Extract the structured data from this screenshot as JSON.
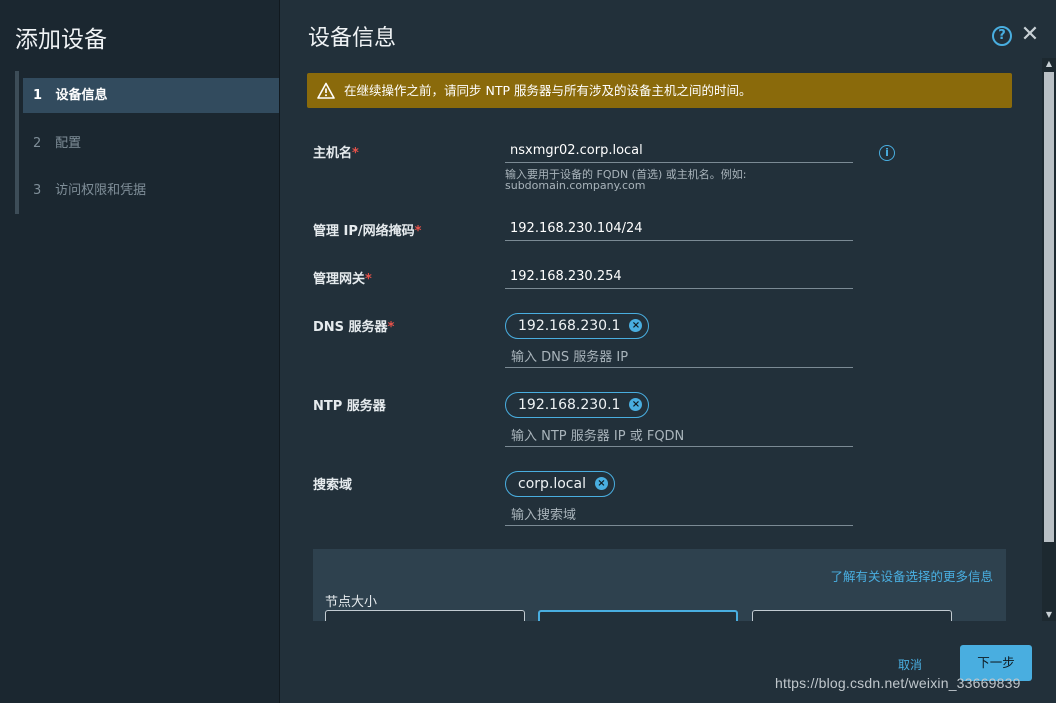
{
  "sidebar": {
    "title": "添加设备",
    "steps": [
      {
        "num": "1",
        "label": "设备信息",
        "active": true
      },
      {
        "num": "2",
        "label": "配置",
        "active": false
      },
      {
        "num": "3",
        "label": "访问权限和凭据",
        "active": false
      }
    ]
  },
  "header": {
    "title": "设备信息",
    "help_icon": "help-circle-icon",
    "help_glyph": "?",
    "close_icon": "close-icon",
    "close_glyph": "✕"
  },
  "alert": {
    "icon": "warning-triangle-icon",
    "text": "在继续操作之前，请同步 NTP 服务器与所有涉及的设备主机之间的时间。",
    "color": "#8a6a0b"
  },
  "form": {
    "hostname": {
      "label": "主机名",
      "required": "*",
      "value": "nsxmgr02.corp.local",
      "helper_line1": "输入要用于设备的 FQDN (首选) 或主机名。例如:",
      "helper_line2": "subdomain.company.com",
      "info_glyph": "i"
    },
    "mgmt_ip": {
      "label": "管理 IP/网络掩码",
      "required": "*",
      "value": "192.168.230.104/24"
    },
    "mgmt_gateway": {
      "label": "管理网关",
      "required": "*",
      "value": "192.168.230.254"
    },
    "dns": {
      "label": "DNS 服务器",
      "required": "*",
      "chip": "192.168.230.1",
      "chip_remove": "×",
      "placeholder": "输入 DNS 服务器 IP"
    },
    "ntp": {
      "label": "NTP 服务器",
      "chip": "192.168.230.1",
      "chip_remove": "×",
      "placeholder": "输入 NTP 服务器 IP 或 FQDN"
    },
    "search_domain": {
      "label": "搜索域",
      "chip": "corp.local",
      "chip_remove": "×",
      "placeholder": "输入搜索域"
    }
  },
  "node_size": {
    "link": "了解有关设备选择的更多信息",
    "label": "节点大小"
  },
  "footer": {
    "cancel": "取消",
    "next": "下一步"
  },
  "watermark": "https://blog.csdn.net/weixin_33669839",
  "colors": {
    "accent": "#49aee0",
    "required": "#e8524a",
    "sidebar_active": "#324b5e"
  }
}
